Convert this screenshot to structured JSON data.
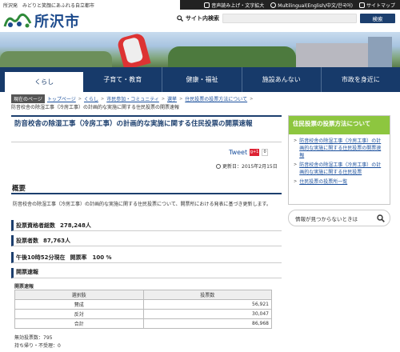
{
  "header": {
    "tagline": "所沢発　みどりと笑顔にあふれる自立都市",
    "logo_text": "所沢市",
    "util": {
      "read_aloud": "音声読み上げ・文字拡大",
      "multilingual": "Multilingual(English/中文/한국어)",
      "sitemap": "サイトマップ"
    },
    "search": {
      "label": "サイト内検索",
      "placeholder": "",
      "button": "検索"
    }
  },
  "nav": {
    "items": [
      {
        "label": "くらし"
      },
      {
        "label": "子育て・教育"
      },
      {
        "label": "健康・福祉"
      },
      {
        "label": "施設あんない"
      },
      {
        "label": "市政を身近に"
      }
    ]
  },
  "breadcrumb": {
    "here": "現在のページ",
    "items": [
      "トップページ",
      "くらし",
      "市民参加・コミュニティ",
      "選挙",
      "住民投票の投票方法について"
    ],
    "last": "防音校舎の除湿工事（冷房工事）の計画的な実施に関する住民投票の開票速報"
  },
  "main": {
    "title": "防音校舎の除湿工事（冷房工事）の計画的な実施に関する住民投票の開票速報",
    "tweet": "Tweet",
    "gplus": "g+1",
    "count": "0",
    "updated": "更新日：2015年2月15日",
    "overview_head": "概要",
    "overview_text": "防音校舎の除湿工事（冷房工事）の計画的な実施に関する住民投票について、開票所における発表に基づき更新します。",
    "stats": [
      {
        "label": "投票資格者総数",
        "value": "278,248人"
      },
      {
        "label": "投票者数",
        "value": "87,763人"
      },
      {
        "label": "午後10時52分現在",
        "value": "開票率　100 %"
      }
    ],
    "results_head": "開票速報",
    "table_caption": "開票速報",
    "table": {
      "headers": [
        "選択肢",
        "投票数"
      ],
      "rows": [
        {
          "label": "賛成",
          "value": "56,921"
        },
        {
          "label": "反対",
          "value": "30,047"
        },
        {
          "label": "合計",
          "value": "86,968"
        }
      ]
    },
    "notes": [
      "無効投票数：795",
      "持ち帰り・不受理：0"
    ]
  },
  "sidebar": {
    "head": "住民投票の投票方法について",
    "links": [
      "防音校舎の除湿工事（冷房工事）の計画的な実施に関する住民投票の開票速報",
      "防音校舎の除湿工事（冷房工事）の計画的な実施に関する住民投票",
      "住民投票の投票所一覧"
    ],
    "feedback": "情報が見つからないときは"
  },
  "colors": {
    "brand_navy": "#173a6a",
    "sidebar_green": "#8dc63f",
    "link_blue": "#1a4f9c"
  }
}
